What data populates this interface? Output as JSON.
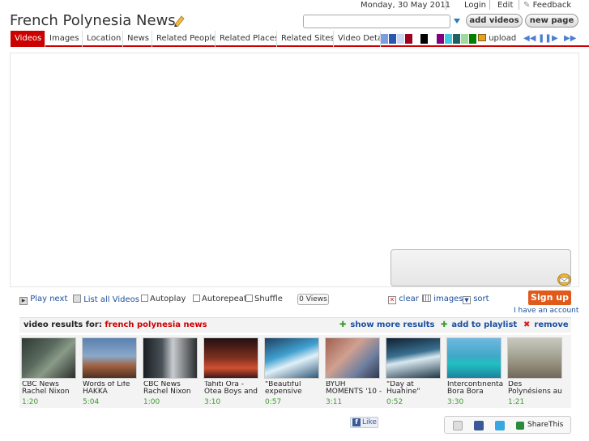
{
  "topbar": {
    "date": "Monday, 30 May 2011",
    "login": "Login",
    "edit": "Edit",
    "feedback": "Feedback"
  },
  "site": {
    "title": "French Polynesia News",
    "icon": "pencil-icon"
  },
  "header": {
    "search_placeholder": "",
    "add_videos": "add videos",
    "new_page": "new page"
  },
  "tabs": [
    {
      "label": "Videos",
      "active": true
    },
    {
      "label": "Images"
    },
    {
      "label": "Location"
    },
    {
      "label": "News"
    },
    {
      "label": "Related People"
    },
    {
      "label": "Related Places"
    },
    {
      "label": "Related Sites"
    },
    {
      "label": "Video Deta"
    }
  ],
  "colors": {
    "accent": "#cc0000",
    "swatches": [
      "#7a9ede",
      "#2a56b0",
      "#c8d8f0",
      "#a00020",
      "#ffffff",
      "#000000",
      "#ffffff",
      "#800080",
      "#40c8e0",
      "#206060",
      "#a0d8a0",
      "#008000"
    ]
  },
  "toolbar": {
    "upload": "upload"
  },
  "controls": {
    "play_next": "Play next",
    "list_all": "List all Videos",
    "autoplay": "Autoplay",
    "autorepeat": "Autorepeat",
    "shuffle": "Shuffle",
    "views": "0 Views",
    "clear": "clear",
    "images": "images",
    "sort": "sort"
  },
  "account": {
    "signup": "Sign up",
    "have_account": "I have an account"
  },
  "results": {
    "label": "video results for:",
    "query": "french polynesia news",
    "show_more": "show more results",
    "add_playlist": "add to playlist",
    "remove": "remove"
  },
  "videos": [
    {
      "title": "CBC News Rachel Nixon",
      "duration": "1:20"
    },
    {
      "title": "Words of Life HAKKA",
      "duration": "5:04"
    },
    {
      "title": "CBC News Rachel Nixon",
      "duration": "1:00"
    },
    {
      "title": "Tahiti Ora - Otea Boys and",
      "duration": "3:10"
    },
    {
      "title": "\"Beautiful expensive",
      "duration": "0:57"
    },
    {
      "title": "BYUH MOMENTS '10 -",
      "duration": "3:11"
    },
    {
      "title": "\"Day at Huahine\"",
      "duration": "0:52"
    },
    {
      "title": "Intercontinenta Bora Bora",
      "duration": "3:30"
    },
    {
      "title": "Des Polynésiens au",
      "duration": "1:21"
    }
  ],
  "social": {
    "like": "Like",
    "share": "ShareThis"
  }
}
